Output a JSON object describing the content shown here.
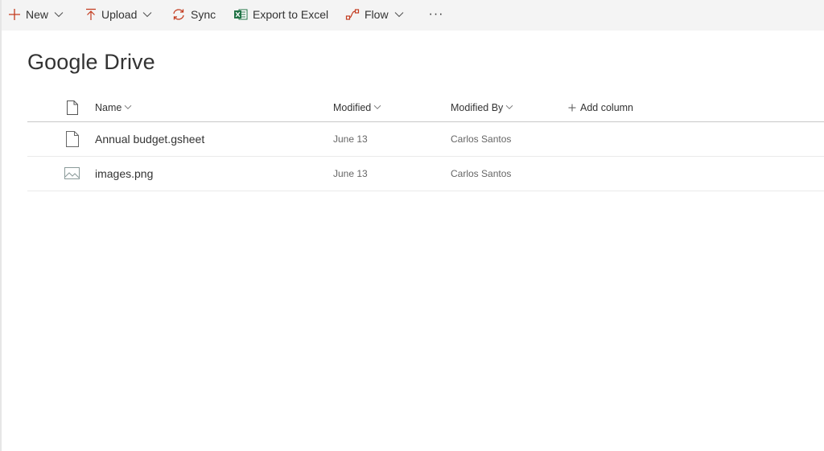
{
  "colors": {
    "accent": "#c33b1e",
    "excel_green": "#217346",
    "toolbar_bg": "#f4f4f4",
    "text": "#333333",
    "muted_text": "#666666"
  },
  "toolbar": {
    "new_label": "New",
    "upload_label": "Upload",
    "sync_label": "Sync",
    "export_label": "Export to Excel",
    "flow_label": "Flow",
    "more_label": "···"
  },
  "page": {
    "title": "Google Drive"
  },
  "table": {
    "columns": {
      "name": "Name",
      "modified": "Modified",
      "modified_by": "Modified By",
      "add_column": "Add column"
    },
    "rows": [
      {
        "icon": "document-icon",
        "name": "Annual budget.gsheet",
        "modified": "June 13",
        "modified_by": "Carlos Santos"
      },
      {
        "icon": "image-icon",
        "name": "images.png",
        "modified": "June 13",
        "modified_by": "Carlos Santos"
      }
    ]
  }
}
